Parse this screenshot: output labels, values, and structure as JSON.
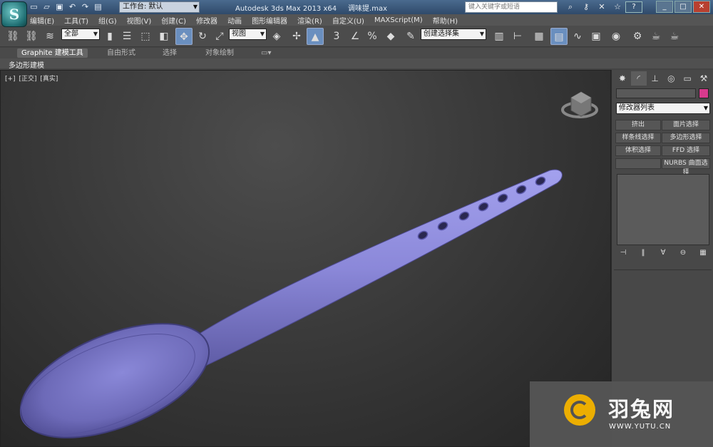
{
  "titlebar": {
    "workspace_label": "工作台: 默认",
    "app_title": "Autodesk 3ds Max  2013 x64",
    "file_name": "调味提.max",
    "search_placeholder": "键入关键字或短语",
    "help_label": "?"
  },
  "menu": [
    "编辑(E)",
    "工具(T)",
    "组(G)",
    "视图(V)",
    "创建(C)",
    "修改器",
    "动画",
    "图形编辑器",
    "渲染(R)",
    "自定义(U)",
    "MAXScript(M)",
    "帮助(H)"
  ],
  "toolbar": {
    "selection_filter": "全部",
    "reference_coord": "视图",
    "named_selection": "创建选择集",
    "snap_value": "3"
  },
  "ribbon": {
    "tabs": [
      "Graphite 建模工具",
      "自由形式",
      "选择",
      "对象绘制"
    ],
    "active_panel": "多边形建模"
  },
  "viewport": {
    "label_plus": "[+]",
    "label_view": "[正交]",
    "label_shading": "[真实]"
  },
  "command_panel": {
    "modifier_list": "修改器列表",
    "buttons": [
      "挤出",
      "面片选择",
      "样条线选择",
      "多边形选择",
      "体积选择",
      "FFD 选择",
      "",
      "NURBS 曲面选择"
    ],
    "object_color": "#d83a8d"
  },
  "watermark": {
    "brand": "羽兔网",
    "url": "WWW.YUTU.CN"
  }
}
